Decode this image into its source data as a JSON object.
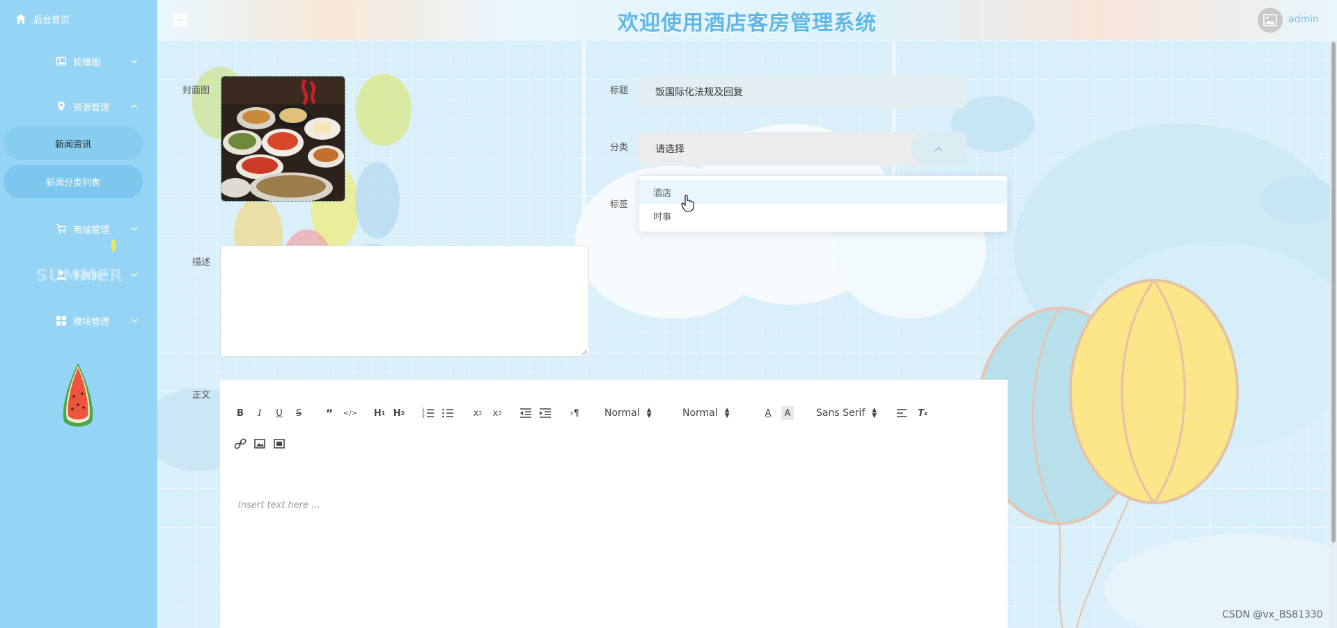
{
  "header": {
    "title": "欢迎使用酒店客房管理系统",
    "username": "admin"
  },
  "sidebar": {
    "home_label": "后台首页",
    "menus": [
      {
        "label": "轮播图",
        "icon": "image-icon"
      },
      {
        "label": "资源管理",
        "icon": "location-icon",
        "expanded": true
      },
      {
        "label": "商城管理",
        "icon": "cart-icon"
      },
      {
        "label": "系统用户",
        "icon": "user-icon"
      },
      {
        "label": "模块管理",
        "icon": "grid-icon"
      }
    ],
    "submenus": [
      {
        "label": "新闻资讯",
        "active": true
      },
      {
        "label": "新闻分类列表",
        "active": false
      }
    ],
    "summer_text": "SUMMER"
  },
  "form": {
    "cover_label": "封面图",
    "title_label": "标题",
    "title_value": "饭国际化法规及回复",
    "category_label": "分类",
    "category_placeholder": "请选择",
    "tags_label": "标签",
    "desc_label": "描述",
    "body_label": "正文",
    "category_options": [
      "酒店",
      "时事"
    ]
  },
  "editor": {
    "header_select": "Normal",
    "size_select": "Normal",
    "font_select": "Sans Serif",
    "placeholder": "Insert text here ..."
  },
  "watermark": "CSDN @vx_BS81330",
  "colors": {
    "sidebar": "#95d4f5",
    "title": "#5fb7e6",
    "accent": "#6cbfea"
  }
}
